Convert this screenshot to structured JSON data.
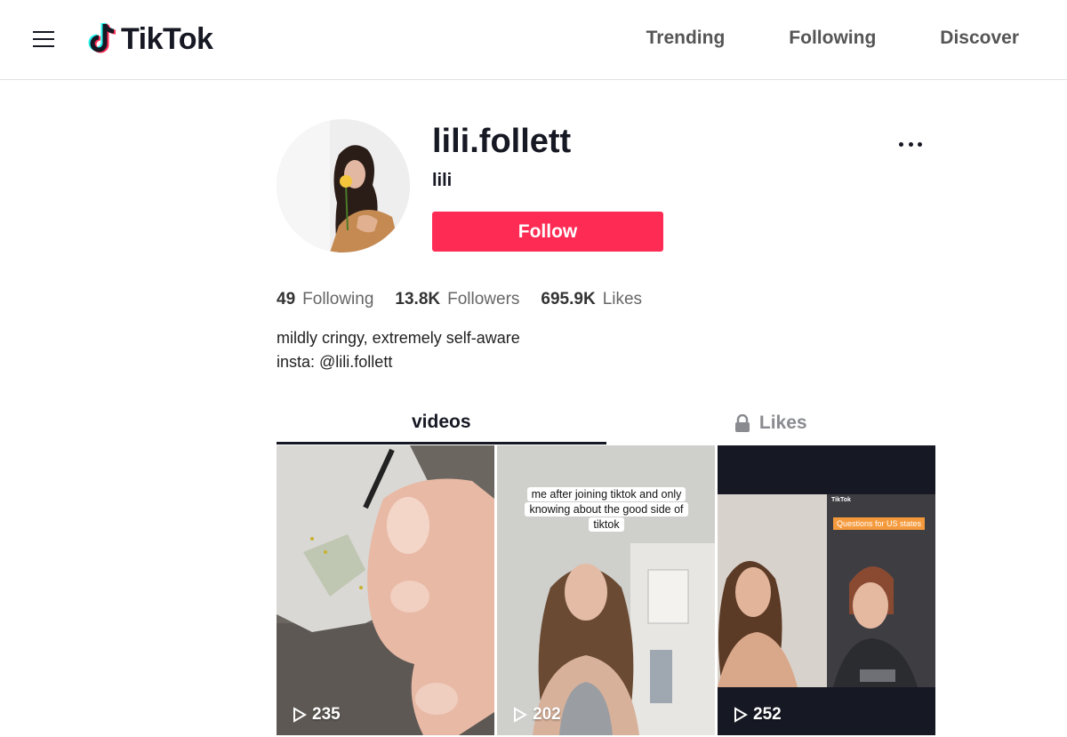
{
  "header": {
    "brand": "TikTok",
    "nav": [
      {
        "label": "Trending"
      },
      {
        "label": "Following"
      },
      {
        "label": "Discover"
      }
    ]
  },
  "profile": {
    "username": "lili.follett",
    "nickname": "lili",
    "follow_label": "Follow",
    "stats": [
      {
        "value": "49",
        "label": "Following"
      },
      {
        "value": "13.8K",
        "label": "Followers"
      },
      {
        "value": "695.9K",
        "label": "Likes"
      }
    ],
    "bio": [
      "mildly cringy, extremely self-aware",
      "insta: @lili.follett"
    ]
  },
  "tabs": [
    {
      "label": "videos",
      "active": true
    },
    {
      "label": "Likes",
      "locked": true
    }
  ],
  "videos": [
    {
      "views": "235"
    },
    {
      "views": "202",
      "caption": "me after joining tiktok and only knowing about the good side of tiktok"
    },
    {
      "views": "252",
      "inner_brand": "TikTok",
      "tag": "Questions for US states"
    }
  ],
  "colors": {
    "accent": "#fe2c55",
    "text": "#161823",
    "muted": "#8a8b91"
  }
}
